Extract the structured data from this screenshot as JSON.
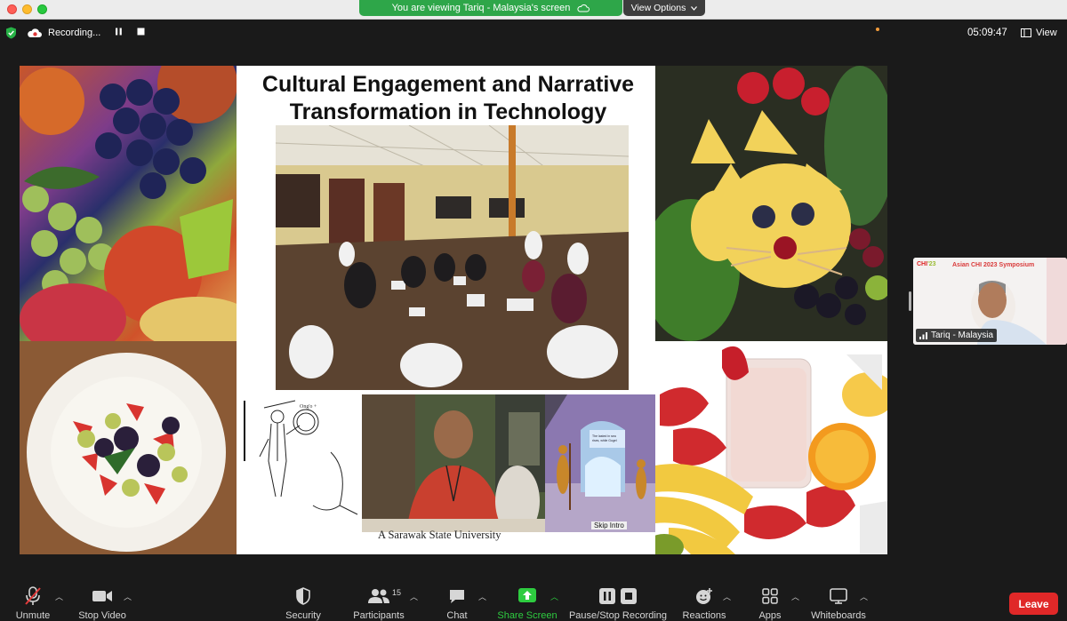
{
  "banner": {
    "viewing_text": "You are viewing Tariq - Malaysia's screen",
    "view_options": "View Options"
  },
  "recording": {
    "label": "Recording..."
  },
  "clock": "05:09:47",
  "view_label": "View",
  "slide": {
    "title_line1": "Cultural Engagement and Narrative",
    "title_line2": "Transformation in Technology Design",
    "caption_university": "A Sarawak State University",
    "caption_skip": "Skip Intro"
  },
  "thumbnail": {
    "event_title": "Asian CHI 2023 Symposium",
    "participant_name": "Tariq - Malaysia"
  },
  "toolbar": {
    "unmute": "Unmute",
    "stop_video": "Stop Video",
    "security": "Security",
    "participants": "Participants",
    "participants_count": "15",
    "chat": "Chat",
    "share_screen": "Share Screen",
    "pause_stop_recording": "Pause/Stop Recording",
    "reactions": "Reactions",
    "apps": "Apps",
    "whiteboards": "Whiteboards",
    "leave": "Leave"
  },
  "colors": {
    "banner_green": "#2ea649",
    "share_green": "#2ecc40",
    "leave_red": "#e02828",
    "toolbar_bg": "#1a1a1a"
  }
}
